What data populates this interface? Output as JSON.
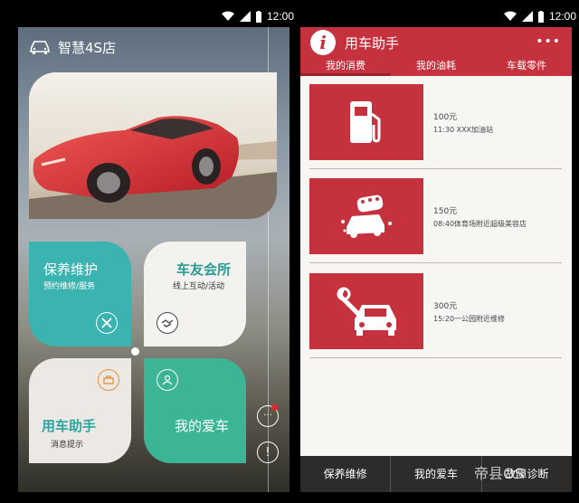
{
  "status": {
    "time": "12:00"
  },
  "left": {
    "title": "智慧4S店",
    "tiles": [
      {
        "title": "保养维护",
        "sub": "预约维修/服务",
        "icon": "tools-icon"
      },
      {
        "title": "车友会所",
        "sub": "线上互动/活动",
        "icon": "handshake-icon"
      },
      {
        "title": "用车助手",
        "sub": "消息提示",
        "icon": "toolbox-icon"
      },
      {
        "title": "我的爱车",
        "sub": "",
        "icon": "user-icon"
      }
    ],
    "side_buttons": [
      "more-icon",
      "info-icon"
    ]
  },
  "right": {
    "title": "用车助手",
    "tabs": [
      "我的消费",
      "我的油耗",
      "车载零件"
    ],
    "items": [
      {
        "amount": "100元",
        "detail": "11:30  XXX加油站",
        "icon": "gas-pump-icon"
      },
      {
        "amount": "150元",
        "detail": "08:40体育场附近超级美容店",
        "icon": "car-wash-icon"
      },
      {
        "amount": "300元",
        "detail": "15:20一公园附近维修",
        "icon": "car-repair-icon"
      }
    ],
    "bottom_nav": [
      "保养维修",
      "我的爱车",
      "故障诊断"
    ]
  },
  "watermark": "帝县OS"
}
